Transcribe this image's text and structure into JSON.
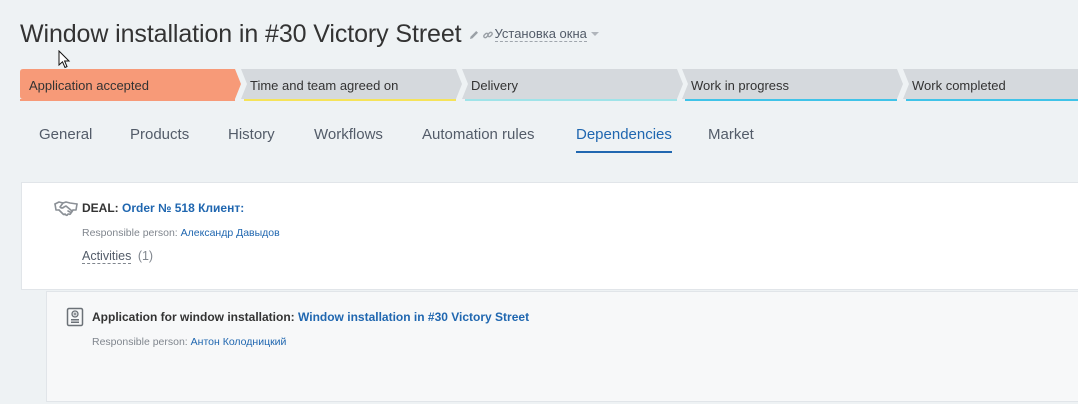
{
  "header": {
    "title": "Window installation in #30 Victory Street",
    "category": "Установка окна"
  },
  "stages": [
    {
      "label": "Application accepted",
      "color": "#f79a78",
      "active": true
    },
    {
      "label": "Time and team agreed on",
      "color": "#f5e35a",
      "active": false
    },
    {
      "label": "Delivery",
      "color": "#9fe3e8",
      "active": false
    },
    {
      "label": "Work in progress",
      "color": "#3fc3e8",
      "active": false
    },
    {
      "label": "Work completed",
      "color": "#3fc3e8",
      "active": false
    }
  ],
  "tabs": [
    {
      "label": "General"
    },
    {
      "label": "Products"
    },
    {
      "label": "History"
    },
    {
      "label": "Workflows"
    },
    {
      "label": "Automation rules"
    },
    {
      "label": "Dependencies"
    },
    {
      "label": "Market"
    }
  ],
  "active_tab": "Dependencies",
  "deal": {
    "type_label": "DEAL:",
    "link": "Order № 518 Клиент:",
    "responsible_label": "Responsible person:",
    "responsible_name": "Александр Давыдов",
    "activities_label": "Activities",
    "activities_count": "(1)"
  },
  "application": {
    "type_label": "Application for window installation:",
    "link": "Window installation in #30 Victory Street",
    "responsible_label": "Responsible person:",
    "responsible_name": "Антон Колодницкий"
  },
  "colors": {
    "accent": "#2067b0",
    "stage_inactive_bg": "#d5d9dd",
    "stage_active_bg": "#f79a78"
  },
  "icons": [
    "pencil-icon",
    "link-icon",
    "chevron-down-icon",
    "handshake-icon",
    "document-icon",
    "mouse-cursor-icon"
  ]
}
